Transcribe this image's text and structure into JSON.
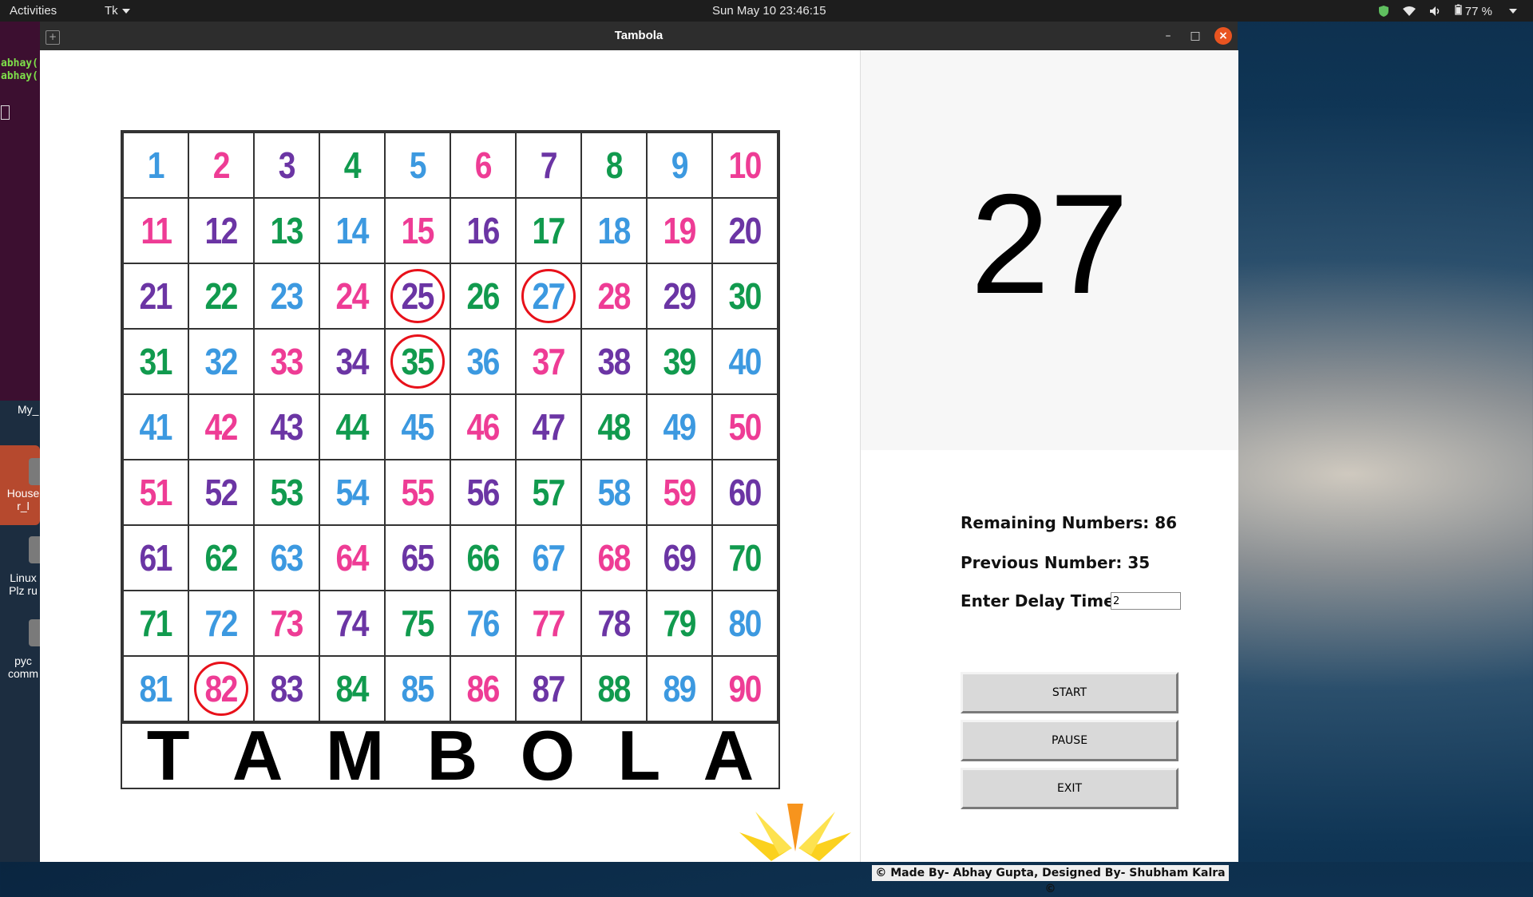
{
  "topbar": {
    "activities": "Activities",
    "app_menu": "Tk",
    "clock": "Sun May 10  23:46:15",
    "battery": "77 %"
  },
  "desktop": {
    "terminal_lines": [
      "abhay(",
      "abhay("
    ],
    "labels": [
      "My_",
      "House r_l",
      "Linux Plz ru",
      "pyc comm"
    ]
  },
  "window": {
    "title": "Tambola",
    "minimize": "–",
    "maximize": "□",
    "close": "×"
  },
  "board": {
    "rows": [
      [
        1,
        2,
        3,
        4,
        5,
        6,
        7,
        8,
        9,
        10
      ],
      [
        11,
        12,
        13,
        14,
        15,
        16,
        17,
        18,
        19,
        20
      ],
      [
        21,
        22,
        23,
        24,
        25,
        26,
        27,
        28,
        29,
        30
      ],
      [
        31,
        32,
        33,
        34,
        35,
        36,
        37,
        38,
        39,
        40
      ],
      [
        41,
        42,
        43,
        44,
        45,
        46,
        47,
        48,
        49,
        50
      ],
      [
        51,
        52,
        53,
        54,
        55,
        56,
        57,
        58,
        59,
        60
      ],
      [
        61,
        62,
        63,
        64,
        65,
        66,
        67,
        68,
        69,
        70
      ],
      [
        71,
        72,
        73,
        74,
        75,
        76,
        77,
        78,
        79,
        80
      ],
      [
        81,
        82,
        83,
        84,
        85,
        86,
        87,
        88,
        89,
        90
      ]
    ],
    "colors": {
      "blue": "#3c99e0",
      "pink": "#ee3c95",
      "purple": "#6b35a4",
      "green": "#119a4e"
    },
    "circled": [
      25,
      27,
      35,
      82
    ],
    "circle_color": "#e8111a",
    "word": [
      "T",
      "A",
      "M",
      "B",
      "O",
      "L",
      "A"
    ]
  },
  "display": {
    "current_number": "27"
  },
  "controls": {
    "remaining_label": "Remaining Numbers: 86",
    "previous_label": "Previous Number: 35",
    "delay_label": "Enter Delay Time:",
    "delay_value": "2",
    "start": "START",
    "pause": "PAUSE",
    "exit": "EXIT",
    "credits": "© Made By- Abhay Gupta, Designed By- Shubham Kalra ©"
  }
}
